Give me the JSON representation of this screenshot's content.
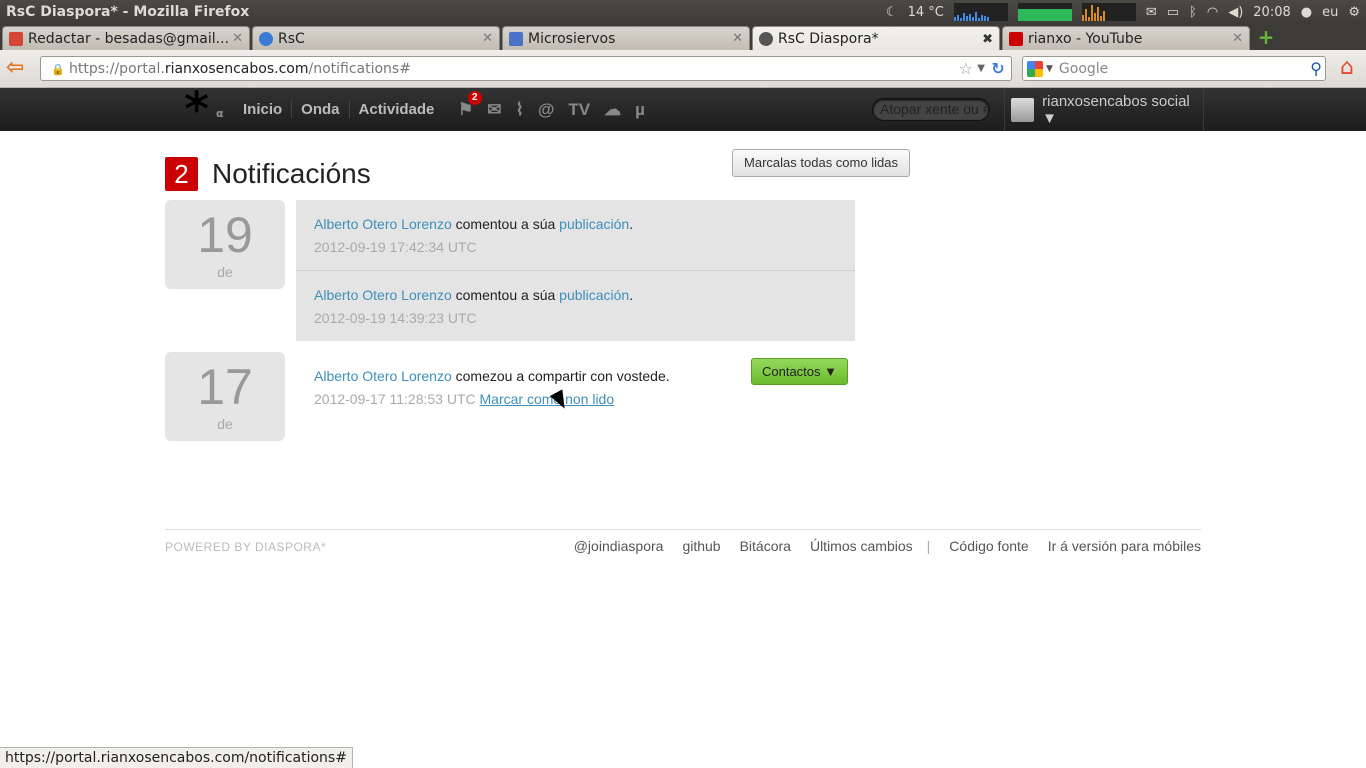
{
  "os": {
    "window_title": "RsC Diaspora* - Mozilla Firefox",
    "temperature": "14 °C",
    "clock": "20:08",
    "user": "eu"
  },
  "tabs": [
    {
      "label": "Redactar - besadas@gmail....",
      "icon": "gmail-icon",
      "color": "#d44638"
    },
    {
      "label": "RsC",
      "icon": "rsc-icon",
      "color": "#3a7bd5"
    },
    {
      "label": "Microsiervos",
      "icon": "cube-icon",
      "color": "#4a72c8"
    },
    {
      "label": "RsC Diaspora*",
      "icon": "diaspora-icon",
      "color": "#555555"
    },
    {
      "label": "rianxo - YouTube",
      "icon": "youtube-icon",
      "color": "#cc0000"
    }
  ],
  "browser": {
    "url_prefix": "https://portal.",
    "url_domain": "rianxosencabos.com",
    "url_path": "/notifications#",
    "search_placeholder": "Google",
    "status_url": "https://portal.rianxosencabos.com/notifications#"
  },
  "diaspora": {
    "nav": [
      "Inicio",
      "Onda",
      "Actividade"
    ],
    "notif_count_badge": "2",
    "icons": [
      "notifications-icon",
      "mail-icon",
      "activity-icon",
      "mentions-icon",
      "tv-icon",
      "cloud-icon",
      "mu-icon"
    ],
    "tv_label": "TV",
    "mention_label": "@",
    "mu_label": "µ",
    "search_placeholder": "Atopar xente ou #",
    "user_name": "rianxosencabos social ▼"
  },
  "page": {
    "count": "2",
    "title": "Notificacións",
    "mark_all": "Marcalas todas como lidas",
    "groups": [
      {
        "day": "19",
        "de": "de",
        "items": [
          {
            "author": "Alberto Otero Lorenzo",
            "text": " comentou a súa ",
            "target": "publicación",
            "end": ".",
            "time": "2012-09-19 17:42:34 UTC"
          },
          {
            "author": "Alberto Otero Lorenzo",
            "text": " comentou a súa ",
            "target": "publicación",
            "end": ".",
            "time": "2012-09-19 14:39:23 UTC"
          }
        ]
      },
      {
        "day": "17",
        "de": "de",
        "items": [
          {
            "author": "Alberto Otero Lorenzo",
            "text": " comezou a compartir con vostede.",
            "time": "2012-09-17 11:28:53 UTC",
            "mark_unread": "Marcar como non lido",
            "button": "Contactos ▼"
          }
        ]
      }
    ]
  },
  "footer": {
    "powered": "POWERED BY DIASPORA*",
    "links": [
      "@joindiaspora",
      "github",
      "Bitácora",
      "Últimos cambios",
      "Código fonte",
      "Ir á versión para móbiles"
    ],
    "separator": "|"
  }
}
